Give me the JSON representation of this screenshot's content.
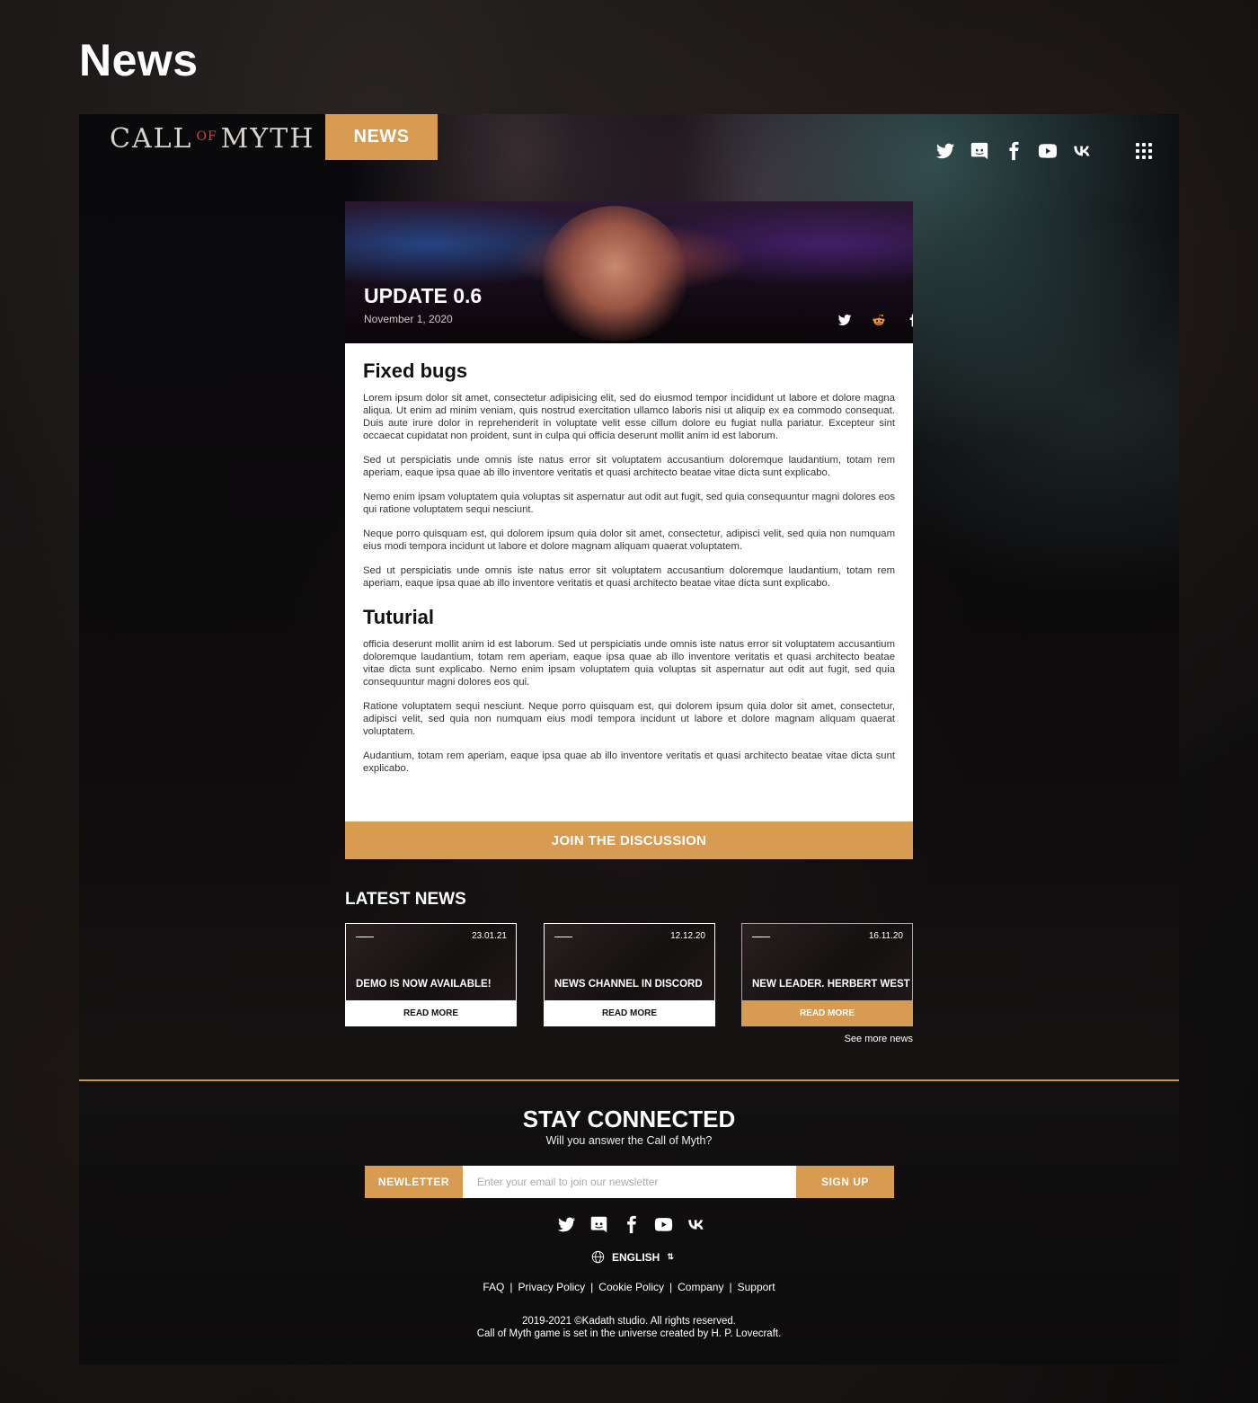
{
  "page_heading": "News",
  "header": {
    "logo": {
      "part1": "CALL",
      "part2": "OF",
      "part3": "MYTH"
    },
    "nav_active": "NEWS",
    "social_icons": [
      "twitter-icon",
      "discord-icon",
      "facebook-icon",
      "youtube-icon",
      "vk-icon"
    ],
    "menu_icon": "apps-grid-icon"
  },
  "hero": {
    "title": "UPDATE 0.6",
    "date": "November 1, 2020",
    "share_icons": [
      "twitter-icon",
      "reddit-icon",
      "facebook-icon"
    ]
  },
  "article": {
    "sections": [
      {
        "heading": "Fixed bugs",
        "paragraphs": [
          "Lorem ipsum dolor sit amet, consectetur adipisicing elit, sed do eiusmod tempor incididunt ut labore et dolore magna aliqua. Ut enim ad minim veniam, quis nostrud exercitation ullamco laboris nisi ut aliquip ex ea commodo consequat. Duis aute irure dolor in reprehenderit in voluptate velit esse cillum dolore eu fugiat nulla pariatur. Excepteur sint occaecat cupidatat non proident, sunt in culpa qui officia deserunt mollit anim id est laborum.",
          "Sed ut perspiciatis unde omnis iste natus error sit voluptatem accusantium doloremque laudantium, totam rem aperiam, eaque ipsa quae ab illo inventore veritatis et quasi architecto beatae vitae dicta sunt explicabo.",
          "Nemo enim ipsam voluptatem quia voluptas sit aspernatur aut odit aut fugit, sed quia consequuntur magni dolores eos qui ratione voluptatem sequi nesciunt.",
          "Neque porro quisquam est, qui dolorem ipsum quia dolor sit amet, consectetur, adipisci velit, sed quia non numquam eius modi tempora incidunt ut labore et dolore magnam aliquam quaerat voluptatem.",
          "Sed ut perspiciatis unde omnis iste natus error sit voluptatem accusantium doloremque laudantium, totam rem aperiam, eaque ipsa quae ab illo inventore veritatis et quasi architecto beatae vitae dicta sunt explicabo."
        ]
      },
      {
        "heading": "Tuturial",
        "paragraphs": [
          "officia deserunt mollit anim id est laborum. Sed ut perspiciatis unde omnis iste natus error sit voluptatem accusantium doloremque laudantium, totam rem aperiam, eaque ipsa quae ab illo inventore veritatis et quasi architecto beatae vitae dicta sunt explicabo. Nemo enim ipsam voluptatem quia voluptas sit aspernatur aut odit aut fugit, sed quia consequuntur magni dolores eos qui.",
          "Ratione voluptatem sequi nesciunt. Neque porro quisquam est, qui dolorem ipsum quia dolor sit amet, consectetur, adipisci velit, sed quia non numquam eius modi tempora incidunt ut labore et dolore magnam aliquam quaerat voluptatem.",
          "Audantium, totam rem aperiam, eaque ipsa quae ab illo inventore veritatis et quasi architecto beatae vitae dicta sunt explicabo."
        ]
      }
    ],
    "join_button": "JOIN THE DISCUSSION"
  },
  "latest_news": {
    "title": "LATEST NEWS",
    "items": [
      {
        "date": "23.01.21",
        "title": "DEMO IS NOW AVAILABLE!",
        "cta": "READ MORE"
      },
      {
        "date": "12.12.20",
        "title": "NEWS CHANNEL IN DISCORD",
        "cta": "READ MORE"
      },
      {
        "date": "16.11.20",
        "title": "NEW LEADER. HERBERT WEST",
        "cta": "READ MORE"
      }
    ],
    "see_more": "See more news"
  },
  "footer": {
    "title": "STAY CONNECTED",
    "subtitle": "Will you answer the Call of Myth?",
    "newsletter": {
      "label": "NEWLETTER",
      "placeholder": "Enter your email to join our newsletter",
      "button": "SIGN UP"
    },
    "social_icons": [
      "twitter-icon",
      "discord-icon",
      "facebook-icon",
      "youtube-icon",
      "vk-icon"
    ],
    "language": "ENGLISH",
    "links": [
      "FAQ",
      "Privacy Policy",
      "Cookie Policy",
      "Company",
      "Support"
    ],
    "copyright_line1": "2019-2021 ©Kadath studio. All rights reserved.",
    "copyright_line2": "Call of Myth game is set in the universe created by H. P. Lovecraft."
  },
  "colors": {
    "accent": "#d89b52",
    "background": "#0b0a0b",
    "card": "#ffffff"
  }
}
